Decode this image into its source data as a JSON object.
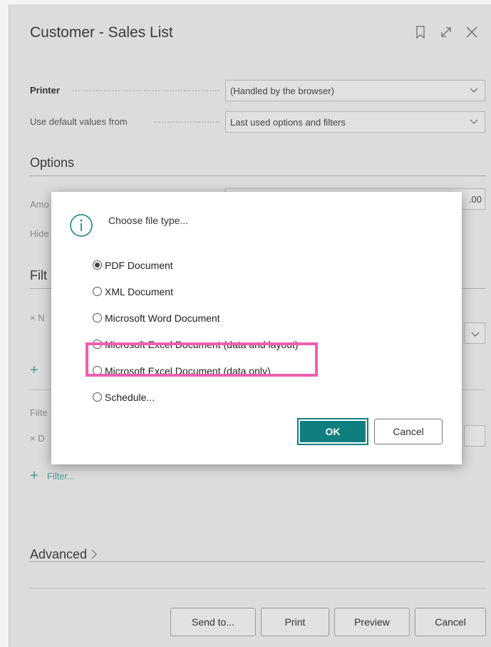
{
  "panel": {
    "title": "Customer - Sales List",
    "printer": {
      "label": "Printer",
      "value": "(Handled by the browser)"
    },
    "defaults": {
      "label": "Use default values from",
      "value": "Last used options and filters"
    },
    "options_title": "Options",
    "obscured": {
      "amount_label_fragment": "Amo",
      "amount_value_fragment": ".00",
      "hide_label_fragment": "Hide",
      "filter_section_fragment": "Filt",
      "filter_item1_fragment": "× N",
      "filter_section2_fragment": "Filte",
      "filter_item2_fragment": "× D"
    },
    "filter_link": "Filter...",
    "advanced": "Advanced",
    "footer": {
      "send_to": "Send to...",
      "print": "Print",
      "preview": "Preview",
      "cancel": "Cancel"
    }
  },
  "dialog": {
    "title": "Choose file type...",
    "options": [
      {
        "label": "PDF Document",
        "checked": true
      },
      {
        "label": "XML Document",
        "checked": false
      },
      {
        "label": "Microsoft Word Document",
        "checked": false
      },
      {
        "label": "Microsoft Excel Document (data and layout)",
        "checked": false
      },
      {
        "label": "Microsoft Excel Document (data only)",
        "checked": false
      },
      {
        "label": "Schedule...",
        "checked": false
      }
    ],
    "ok": "OK",
    "cancel": "Cancel",
    "highlight_color": "#ef5fb0",
    "accent_color": "#0e7e7f"
  }
}
